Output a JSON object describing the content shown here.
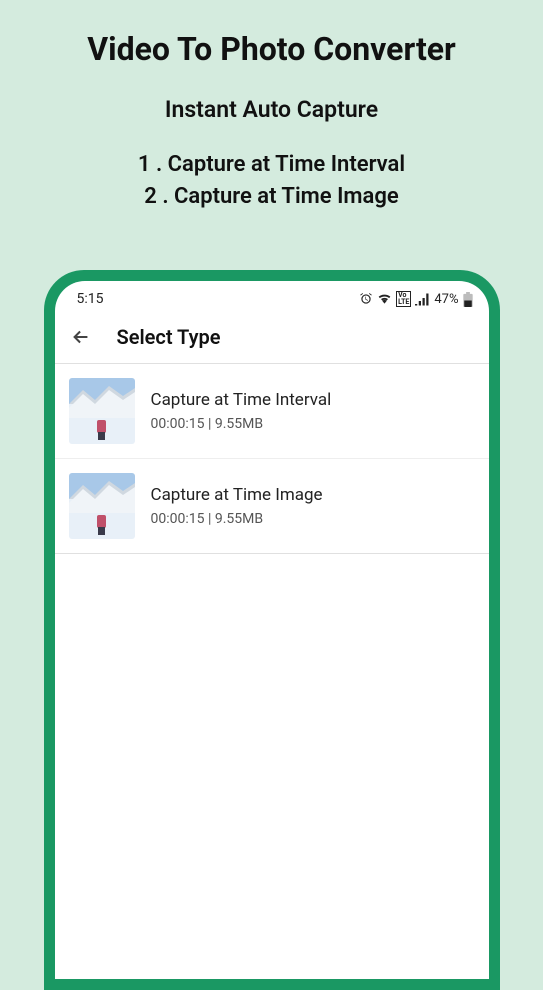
{
  "promo": {
    "title": "Video To Photo Converter",
    "subtitle": "Instant Auto Capture",
    "line1": "1 . Capture at Time Interval",
    "line2": "2 . Capture at Time Image"
  },
  "statusbar": {
    "time": "5:15",
    "battery": "47%",
    "lte": "Vo LTE"
  },
  "header": {
    "title": "Select Type"
  },
  "items": [
    {
      "title": "Capture at Time Interval",
      "meta": "00:00:15  |  9.55MB"
    },
    {
      "title": "Capture at Time Image",
      "meta": "00:00:15  |  9.55MB"
    }
  ]
}
